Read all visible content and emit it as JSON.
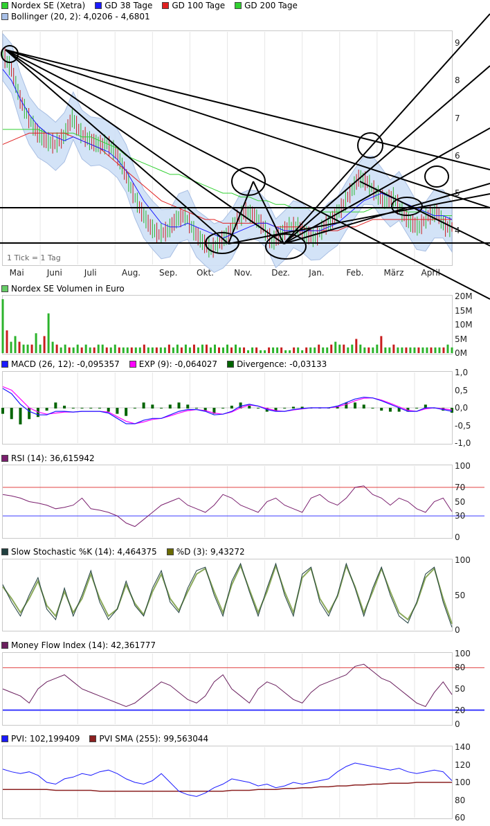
{
  "colors": {
    "price_bar_up": "#2bb32b",
    "price_bar_down": "#c81e1e",
    "bollinger_fill": "#cfe0f7",
    "bollinger_line": "#9fb8e0",
    "gd38": "#1a1aff",
    "gd100": "#e02020",
    "gd200": "#30d030",
    "volume_bar": "#2bb32b",
    "volume_bar_down": "#c81e1e",
    "macd": "#1a1aff",
    "exp": "#ff00ff",
    "divergence": "#006400",
    "rsi": "#7a1f6e",
    "rsi_band_high": "#e04040",
    "rsi_band_low": "#3a3aff",
    "stoch_k": "#204040",
    "stoch_d": "#8aa85a",
    "mfi": "#6a1f5e",
    "pvi": "#1a1aff",
    "pvi_sma": "#8b2020",
    "trendline": "#000000"
  },
  "legend": {
    "price": [
      {
        "label": "Nordex SE (Xetra)",
        "color": "#30d030"
      },
      {
        "label": "GD 38 Tage",
        "color": "#1a1aff"
      },
      {
        "label": "GD 100 Tage",
        "color": "#e02020"
      },
      {
        "label": "GD 200 Tage",
        "color": "#30d030"
      }
    ],
    "bollinger": {
      "label": "Bollinger (20, 2): 4,0206 - 4,6801",
      "color": "#a8c0e8"
    },
    "volume": {
      "label": "Nordex SE Volumen in Euro",
      "color": "#66cc66"
    },
    "macd": [
      {
        "label": "MACD (26, 12): -0,095357",
        "color": "#1a1aff"
      },
      {
        "label": "EXP (9): -0,064027",
        "color": "#ff00ff"
      },
      {
        "label": "Divergence: -0,03133",
        "color": "#006400"
      }
    ],
    "rsi": {
      "label": "RSI (14): 36,615942",
      "color": "#7a1f6e"
    },
    "stoch": [
      {
        "label": "Slow Stochastic %K (14): 4,464375",
        "color": "#204040"
      },
      {
        "label": "%D (3): 9,43272",
        "color": "#6b6b00"
      }
    ],
    "mfi": {
      "label": "Money Flow Index (14): 42,361777",
      "color": "#6a1f5e"
    },
    "pvi": [
      {
        "label": "PVI: 102,199409",
        "color": "#1a1aff"
      },
      {
        "label": "PVI SMA (255): 99,563044",
        "color": "#8b2020"
      }
    ]
  },
  "tick_note": "1 Tick = 1 Tag",
  "chart_data": [
    {
      "type": "candlestick",
      "title": "Nordex SE (Xetra)",
      "x_labels": [
        "Mai",
        "Juni",
        "Juli",
        "Aug.",
        "Sep.",
        "Okt.",
        "Nov.",
        "Dez.",
        "Jan.",
        "Feb.",
        "März",
        "April"
      ],
      "y_ticks": [
        "4",
        "5",
        "6",
        "7",
        "8",
        "9"
      ],
      "ylim": [
        3.1,
        9.3
      ],
      "series": [
        {
          "name": "Nordex SE (Xetra)",
          "x": [
            0,
            5,
            10,
            15,
            20,
            25,
            30,
            35,
            40,
            45,
            50,
            55,
            60,
            65,
            70,
            75,
            80,
            85,
            90,
            95,
            100,
            105,
            110,
            115,
            120,
            125,
            130,
            135,
            140,
            145,
            150,
            155,
            160,
            165,
            170,
            175,
            180,
            185,
            190,
            195,
            200,
            205,
            210,
            215,
            220,
            225,
            230,
            235,
            240,
            245,
            250,
            255
          ],
          "values": [
            8.7,
            8.3,
            7.5,
            7.0,
            6.6,
            6.4,
            6.3,
            6.5,
            7.0,
            6.6,
            6.4,
            6.3,
            6.3,
            6.1,
            5.6,
            5.0,
            4.5,
            4.1,
            3.9,
            4.0,
            4.3,
            4.4,
            4.0,
            3.7,
            3.5,
            3.7,
            3.9,
            4.3,
            4.5,
            4.4,
            4.1,
            3.7,
            3.9,
            4.1,
            4.1,
            3.9,
            3.8,
            4.1,
            4.3,
            4.6,
            5.0,
            5.4,
            5.3,
            5.0,
            4.8,
            4.9,
            4.5,
            4.2,
            4.1,
            4.4,
            4.5,
            4.1
          ]
        },
        {
          "name": "GD 38 Tage",
          "values": [
            8.3,
            8.0,
            7.5,
            7.1,
            6.8,
            6.6,
            6.5,
            6.4,
            6.5,
            6.4,
            6.3,
            6.2,
            6.1,
            5.9,
            5.6,
            5.2,
            4.8,
            4.5,
            4.2,
            4.1,
            4.1,
            4.2,
            4.1,
            4.0,
            3.9,
            3.8,
            3.9,
            4.0,
            4.1,
            4.2,
            4.2,
            4.1,
            4.0,
            4.0,
            4.0,
            4.0,
            4.0,
            4.1,
            4.2,
            4.4,
            4.6,
            4.8,
            4.9,
            5.0,
            4.9,
            4.8,
            4.7,
            4.6,
            4.5,
            4.4,
            4.4,
            4.3
          ]
        },
        {
          "name": "GD 100 Tage",
          "values": [
            6.3,
            6.4,
            6.5,
            6.6,
            6.6,
            6.6,
            6.6,
            6.6,
            6.5,
            6.4,
            6.3,
            6.2,
            6.0,
            5.8,
            5.6,
            5.4,
            5.2,
            5.0,
            4.8,
            4.7,
            4.6,
            4.5,
            4.4,
            4.3,
            4.3,
            4.2,
            4.2,
            4.2,
            4.2,
            4.2,
            4.2,
            4.1,
            4.1,
            4.1,
            4.1,
            4.0,
            4.0,
            4.0,
            4.0,
            4.1,
            4.1,
            4.2,
            4.3,
            4.3,
            4.3,
            4.3,
            4.3,
            4.3,
            4.3,
            4.3,
            4.3,
            4.3
          ]
        },
        {
          "name": "GD 200 Tage",
          "values": [
            6.7,
            6.7,
            6.7,
            6.7,
            6.7,
            6.6,
            6.6,
            6.6,
            6.6,
            6.5,
            6.5,
            6.4,
            6.3,
            6.2,
            6.0,
            5.9,
            5.8,
            5.7,
            5.6,
            5.5,
            5.5,
            5.4,
            5.3,
            5.2,
            5.1,
            5.0,
            5.0,
            4.9,
            4.9,
            4.8,
            4.8,
            4.7,
            4.7,
            4.6,
            4.6,
            4.6,
            4.5,
            4.5,
            4.5,
            4.5,
            4.5,
            4.5,
            4.6,
            4.6,
            4.6,
            4.6,
            4.5,
            4.5,
            4.5,
            4.4,
            4.4,
            4.4
          ]
        }
      ]
    },
    {
      "type": "bar",
      "title": "Nordex SE Volumen in Euro",
      "y_ticks": [
        "20M",
        "15M",
        "10M",
        "5M",
        "0M"
      ],
      "ylim": [
        0,
        20
      ],
      "values": [
        19,
        8,
        4,
        6,
        4,
        3,
        3,
        3,
        7,
        3,
        6,
        14,
        4,
        3,
        2,
        3,
        2,
        2,
        3,
        2,
        3,
        2,
        2,
        3,
        3,
        2,
        2,
        3,
        2,
        2,
        2,
        2,
        2,
        2,
        3,
        2,
        2,
        2,
        2,
        2,
        3,
        2,
        3,
        2,
        3,
        2,
        3,
        2,
        3,
        3,
        2,
        3,
        2,
        2,
        3,
        2,
        3,
        2,
        2,
        1,
        2,
        2,
        1,
        1,
        2,
        2,
        2,
        2,
        1,
        1,
        2,
        2,
        1,
        2,
        2,
        2,
        3,
        2,
        2,
        3,
        4,
        3,
        3,
        2,
        3,
        5,
        3,
        2,
        2,
        2,
        3,
        6,
        2,
        2,
        3,
        2,
        2,
        2,
        2,
        2,
        2,
        2,
        2,
        2,
        2,
        2,
        2,
        3,
        2
      ]
    },
    {
      "type": "line",
      "title": "MACD (26, 12)",
      "y_ticks": [
        "1,0",
        "0,5",
        "0,0",
        "-0,5",
        "-1,0"
      ],
      "ylim": [
        -1,
        1
      ],
      "series": [
        {
          "name": "MACD (26, 12)",
          "values": [
            0.55,
            0.4,
            0.1,
            -0.1,
            -0.2,
            -0.2,
            -0.1,
            -0.1,
            -0.12,
            -0.1,
            -0.1,
            -0.1,
            -0.15,
            -0.3,
            -0.45,
            -0.45,
            -0.35,
            -0.3,
            -0.3,
            -0.2,
            -0.1,
            -0.05,
            -0.05,
            -0.1,
            -0.2,
            -0.18,
            -0.1,
            0.05,
            0.1,
            0.05,
            -0.05,
            -0.1,
            -0.1,
            -0.05,
            -0.02,
            0.0,
            0.0,
            0.0,
            0.05,
            0.15,
            0.25,
            0.3,
            0.28,
            0.2,
            0.1,
            0.0,
            -0.1,
            -0.1,
            0.0,
            0.0,
            -0.05,
            -0.1
          ]
        },
        {
          "name": "EXP (9)",
          "values": [
            0.6,
            0.5,
            0.25,
            0.0,
            -0.12,
            -0.18,
            -0.15,
            -0.12,
            -0.12,
            -0.1,
            -0.1,
            -0.1,
            -0.12,
            -0.25,
            -0.38,
            -0.45,
            -0.4,
            -0.33,
            -0.3,
            -0.23,
            -0.15,
            -0.08,
            -0.05,
            -0.08,
            -0.15,
            -0.18,
            -0.12,
            0.0,
            0.08,
            0.05,
            -0.02,
            -0.08,
            -0.1,
            -0.06,
            -0.03,
            0.0,
            0.0,
            0.0,
            0.03,
            0.1,
            0.2,
            0.27,
            0.28,
            0.22,
            0.13,
            0.03,
            -0.07,
            -0.1,
            -0.03,
            0.0,
            -0.03,
            -0.06
          ]
        }
      ]
    },
    {
      "type": "line",
      "title": "RSI (14)",
      "y_ticks": [
        "100",
        "70",
        "50",
        "30",
        "0"
      ],
      "ylim": [
        0,
        100
      ],
      "series": [
        {
          "name": "RSI (14)",
          "values": [
            60,
            58,
            55,
            50,
            48,
            45,
            40,
            42,
            45,
            55,
            40,
            38,
            35,
            30,
            20,
            15,
            25,
            35,
            45,
            50,
            55,
            45,
            40,
            35,
            45,
            60,
            55,
            45,
            40,
            35,
            50,
            55,
            45,
            40,
            35,
            55,
            60,
            50,
            45,
            55,
            70,
            72,
            60,
            55,
            45,
            55,
            50,
            40,
            35,
            50,
            55,
            36
          ]
        }
      ]
    },
    {
      "type": "line",
      "title": "Slow Stochastic",
      "y_ticks": [
        "100",
        "50",
        "0"
      ],
      "ylim": [
        0,
        100
      ],
      "series": [
        {
          "name": "Slow Stochastic %K (14)",
          "values": [
            65,
            40,
            20,
            50,
            75,
            30,
            15,
            60,
            20,
            50,
            85,
            40,
            15,
            30,
            70,
            35,
            20,
            60,
            85,
            40,
            25,
            60,
            85,
            90,
            50,
            20,
            70,
            95,
            55,
            20,
            60,
            95,
            50,
            20,
            80,
            90,
            40,
            20,
            50,
            95,
            60,
            20,
            60,
            90,
            50,
            20,
            10,
            40,
            80,
            90,
            40,
            4
          ]
        },
        {
          "name": "%D (3)",
          "values": [
            62,
            45,
            25,
            45,
            70,
            35,
            20,
            55,
            25,
            45,
            80,
            45,
            20,
            30,
            65,
            38,
            22,
            55,
            80,
            45,
            28,
            55,
            80,
            88,
            55,
            25,
            65,
            92,
            58,
            25,
            55,
            92,
            55,
            25,
            75,
            88,
            45,
            25,
            48,
            92,
            62,
            25,
            55,
            88,
            55,
            25,
            15,
            38,
            75,
            88,
            45,
            9
          ]
        }
      ]
    },
    {
      "type": "line",
      "title": "Money Flow Index (14)",
      "y_ticks": [
        "100",
        "80",
        "50",
        "20",
        "0"
      ],
      "ylim": [
        0,
        100
      ],
      "series": [
        {
          "name": "Money Flow Index (14)",
          "values": [
            50,
            45,
            40,
            30,
            50,
            60,
            65,
            70,
            60,
            50,
            45,
            40,
            35,
            30,
            25,
            30,
            40,
            50,
            60,
            55,
            45,
            35,
            30,
            40,
            60,
            70,
            50,
            40,
            30,
            50,
            60,
            55,
            45,
            35,
            30,
            45,
            55,
            60,
            65,
            70,
            82,
            85,
            75,
            65,
            60,
            50,
            40,
            30,
            25,
            45,
            60,
            42
          ]
        }
      ]
    },
    {
      "type": "line",
      "title": "PVI",
      "y_ticks": [
        "140",
        "120",
        "100",
        "80",
        "60"
      ],
      "ylim": [
        60,
        140
      ],
      "series": [
        {
          "name": "PVI",
          "values": [
            115,
            112,
            110,
            112,
            108,
            100,
            98,
            104,
            106,
            110,
            108,
            112,
            114,
            110,
            104,
            100,
            98,
            102,
            110,
            100,
            90,
            86,
            84,
            88,
            94,
            98,
            104,
            102,
            100,
            96,
            98,
            94,
            96,
            100,
            98,
            100,
            102,
            104,
            112,
            118,
            122,
            120,
            118,
            116,
            114,
            116,
            112,
            110,
            112,
            114,
            112,
            102
          ]
        },
        {
          "name": "PVI SMA (255)",
          "values": [
            92,
            92,
            92,
            92,
            92,
            92,
            91,
            91,
            91,
            91,
            91,
            90,
            90,
            90,
            90,
            90,
            90,
            90,
            90,
            90,
            90,
            90,
            90,
            90,
            90,
            90,
            91,
            91,
            91,
            92,
            92,
            92,
            93,
            93,
            94,
            94,
            95,
            95,
            96,
            96,
            97,
            97,
            98,
            98,
            99,
            99,
            99,
            100,
            100,
            100,
            100,
            100
          ]
        }
      ]
    }
  ]
}
